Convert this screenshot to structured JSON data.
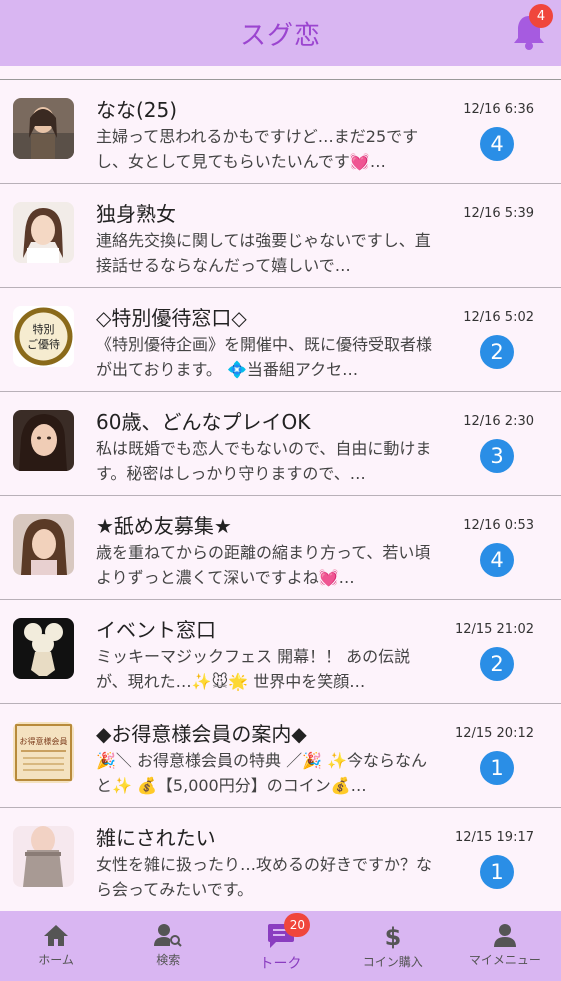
{
  "header": {
    "title": "スグ恋",
    "notification_count": "4"
  },
  "colors": {
    "header_bg": "#d9b6f2",
    "accent": "#9b45d0",
    "count_badge": "#2a8ee6",
    "alert_badge": "#f0463c"
  },
  "messages": [
    {
      "name": "なな(25)",
      "preview": "主婦って思われるかもですけど…まだ25ですし、女として見てもらいたいんです💓…",
      "time": "12/16 6:36",
      "unread": "4",
      "avatar_icon": "woman-photo-avatar"
    },
    {
      "name": "独身熟女",
      "preview": "連絡先交換に関しては強要じゃないですし、直接話せるならなんだって嬉しいで…",
      "time": "12/16 5:39",
      "unread": "",
      "avatar_icon": "woman-photo-avatar"
    },
    {
      "name": "◇特別優待窓口◇",
      "preview": "《特別優待企画》を開催中、既に優待受取者様が出ております。 💠当番組アクセ…",
      "time": "12/16 5:02",
      "unread": "2",
      "avatar_icon": "special-offer-seal",
      "avatar_text": "特別ご優待"
    },
    {
      "name": "60歳、どんなプレイOK",
      "preview": "私は既婚でも恋人でもないので、自由に動けます。秘密はしっかり守りますので、…",
      "time": "12/16 2:30",
      "unread": "3",
      "avatar_icon": "woman-photo-avatar"
    },
    {
      "name": "★舐め友募集★",
      "preview": "歳を重ねてからの距離の縮まり方って、若い頃よりずっと濃くて深いですよね💓…",
      "time": "12/16 0:53",
      "unread": "4",
      "avatar_icon": "woman-photo-avatar"
    },
    {
      "name": "イベント窓口",
      "preview": "ミッキーマジックフェス 開幕！！ あの伝説が、現れた…✨🐭🌟 世界中を笑顔…",
      "time": "12/15 21:02",
      "unread": "2",
      "avatar_icon": "mickey-figure-avatar"
    },
    {
      "name": "◆お得意様会員の案内◆",
      "preview": "🎉＼ お得意様会員の特典 ／🎉 ✨今ならなんと✨ 💰【5,000円分】のコイン💰…",
      "time": "12/15 20:12",
      "unread": "1",
      "avatar_icon": "vip-member-card",
      "avatar_text": "お得意様会員"
    },
    {
      "name": "雑にされたい",
      "preview": "女性を雑に扱ったり…攻めるの好きですか？なら会ってみたいです。",
      "time": "12/15 19:17",
      "unread": "1",
      "avatar_icon": "woman-photo-avatar"
    }
  ],
  "tabs": [
    {
      "label": "ホーム",
      "icon": "home-icon"
    },
    {
      "label": "検索",
      "icon": "user-search-icon"
    },
    {
      "label": "トーク",
      "icon": "chat-icon",
      "badge": "20",
      "active": true
    },
    {
      "label": "コイン購入",
      "icon": "dollar-icon"
    },
    {
      "label": "マイメニュー",
      "icon": "user-icon"
    }
  ]
}
